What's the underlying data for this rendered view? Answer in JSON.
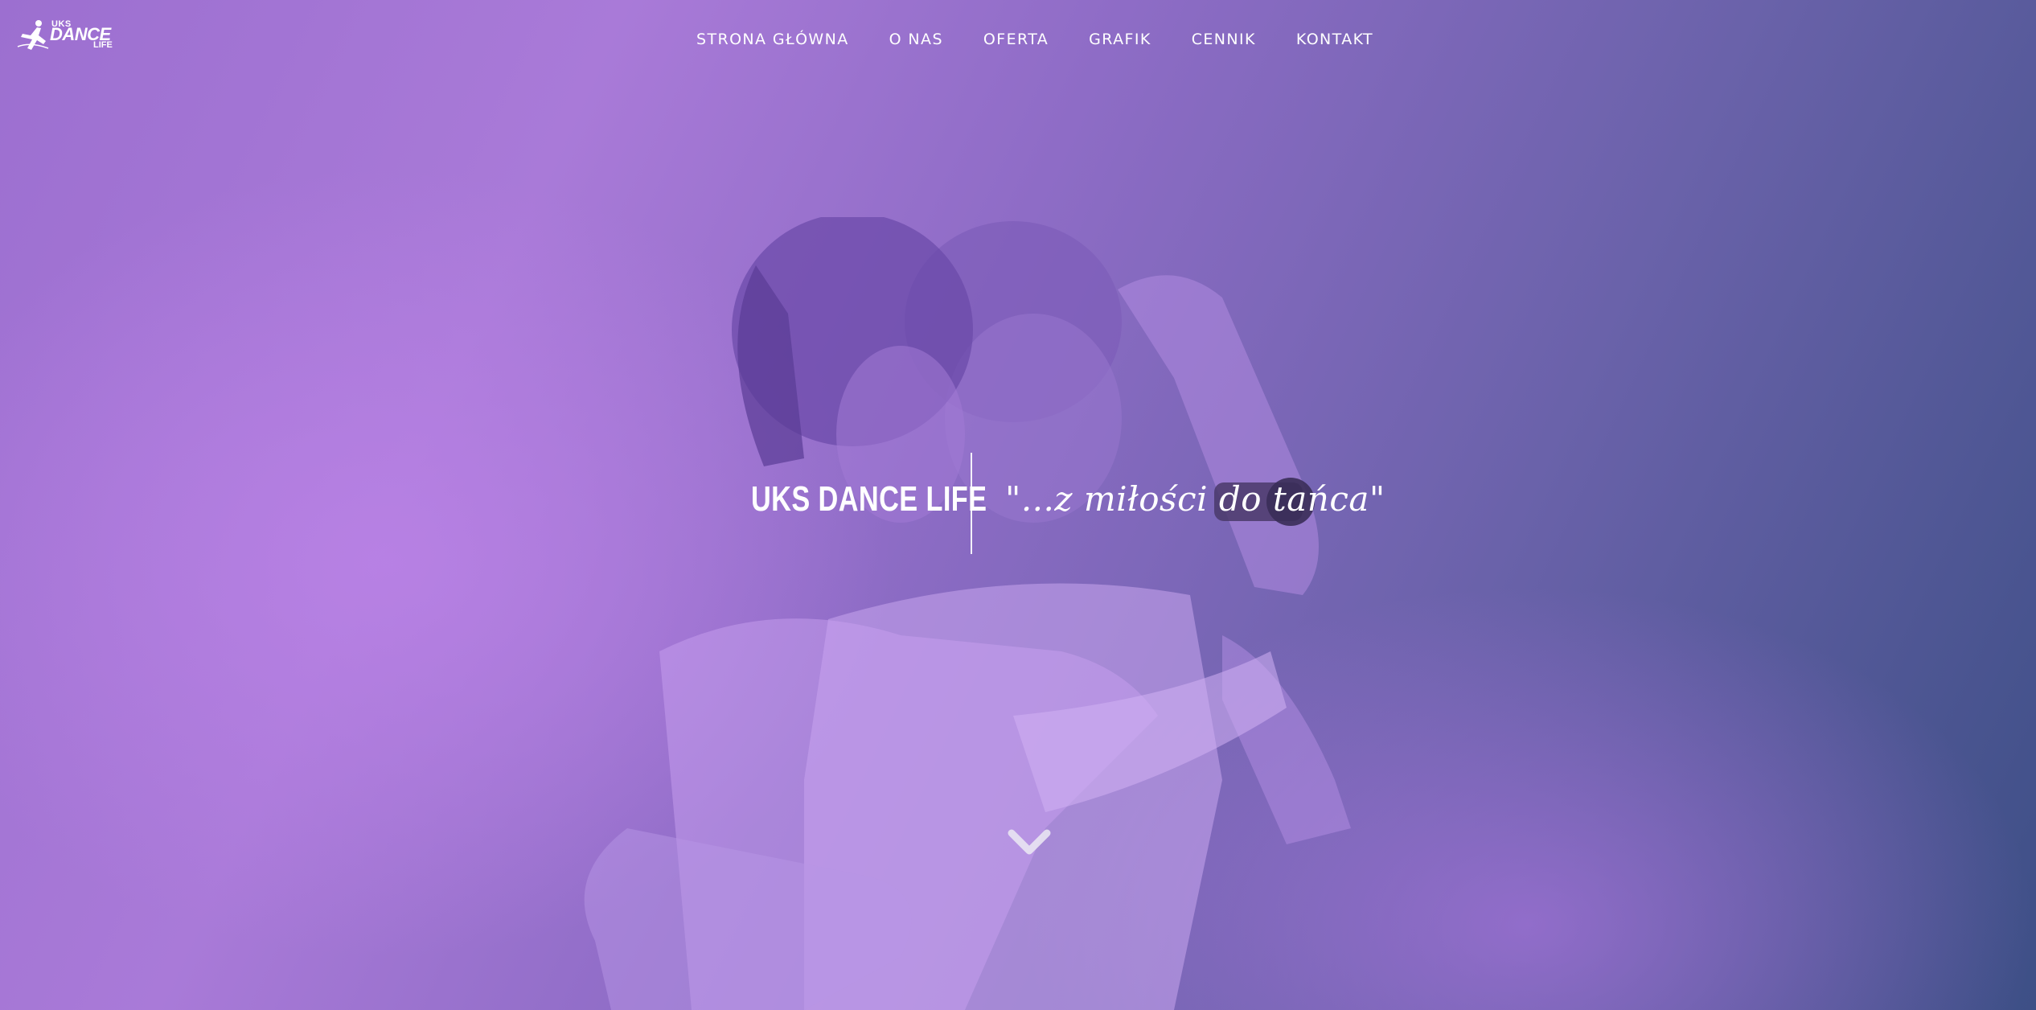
{
  "brand": {
    "logo_top": "UKS",
    "logo_mid": "DANCE",
    "logo_bot": "LIFE"
  },
  "nav": {
    "items": [
      {
        "label": "STRONA GŁÓWNA"
      },
      {
        "label": "O NAS"
      },
      {
        "label": "OFERTA"
      },
      {
        "label": "GRAFIK"
      },
      {
        "label": "CENNIK"
      },
      {
        "label": "KONTAKT"
      }
    ]
  },
  "hero": {
    "title": "UKS DANCE LIFE",
    "tagline": "\"...z miłości do tańca\"",
    "scroll_icon": "chevron-down-icon"
  },
  "colors": {
    "overlay_left": "#a97ad8",
    "overlay_right": "#3d4f86",
    "text": "#ffffff"
  }
}
